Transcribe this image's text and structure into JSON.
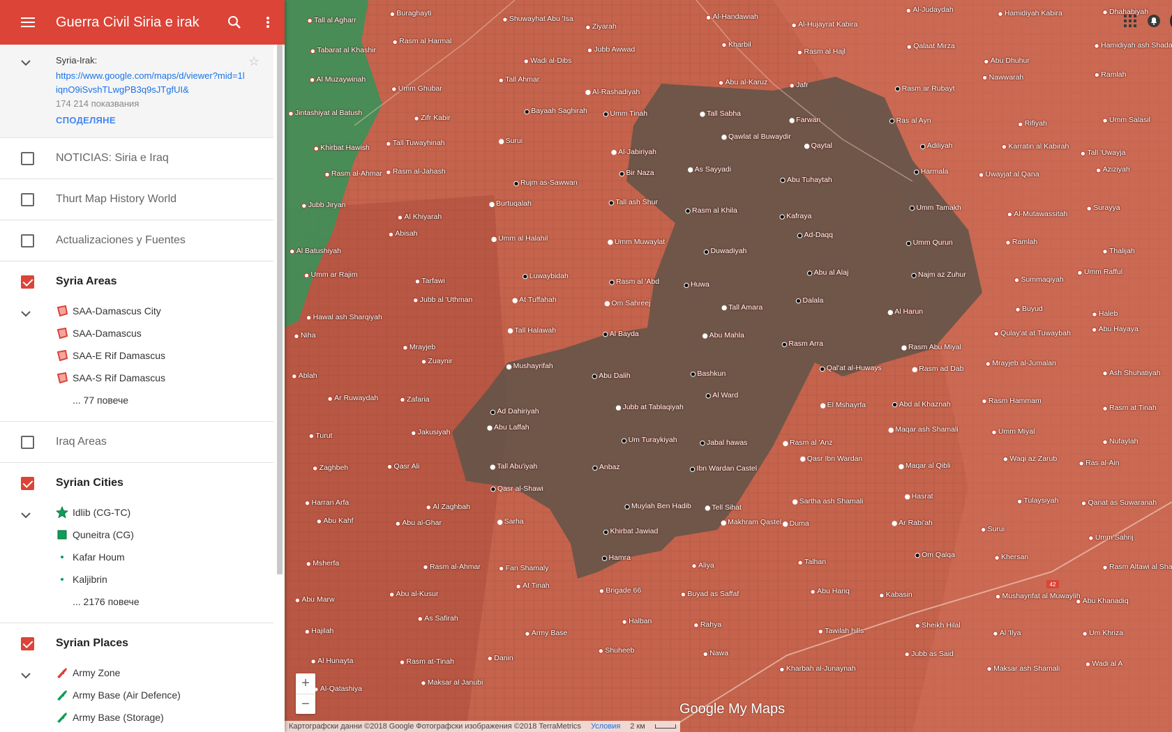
{
  "app": {
    "title": "Guerra Civil Siria e irak"
  },
  "map_info": {
    "name": "Syria-Irak:",
    "url": "https://www.google.com/maps/d/viewer?mid=1liqnO9iSvshTLwgPB3q9sJTgfUI&",
    "views": "174 214 показвания",
    "share_label": "СПОДЕЛЯНЕ"
  },
  "layers": [
    {
      "label": "NOTICIAS: Siria e Iraq",
      "checked": false
    },
    {
      "label": "Thurt Map History World",
      "checked": false
    },
    {
      "label": "Actualizaciones y Fuentes",
      "checked": false
    },
    {
      "label": "Syria Areas",
      "checked": true,
      "items": [
        "SAA-Damascus City",
        "SAA-Damascus",
        "SAA-E Rif Damascus",
        "SAA-S Rif Damascus"
      ],
      "more": "... 77 повече"
    },
    {
      "label": "Iraq Areas",
      "checked": false
    },
    {
      "label": "Syrian Cities",
      "checked": true,
      "items": [
        "Idlib (CG-TC)",
        "Quneitra (CG)",
        "Kafar Houm",
        "Kaljibrin"
      ],
      "more": "... 2176 повече"
    },
    {
      "label": "Syrian Places",
      "checked": true,
      "items": [
        "Army Zone",
        "Army Base (Air Defence)",
        "Army Base (Storage)"
      ]
    }
  ],
  "map": {
    "places": [
      "Tall al Agharr",
      "Buraghayti",
      "Shuwayhat Abu 'Isa",
      "Ziyarah",
      "Al-Handawiah",
      "Al-Hujayrat Kabira",
      "Al-Judaydah",
      "Hamidiyah Kabira",
      "Dhahabiyah",
      "Tabarat al Khashir",
      "Rasm al Harmal",
      "Wadi al-Dibs",
      "Jubb Awwad",
      "Kharbil",
      "Rasm al Hajl",
      "Qalaat Mirza",
      "Abu Dhuhur",
      "Hamidiyah ash Shadad",
      "Al Muzaywinah",
      "Umm Ghubar",
      "Tall Ahmar",
      "Al-Rashadiyah",
      "Abu al-Karuz",
      "Jafr",
      "Rasm ar Rubayt",
      "Nawwarah",
      "Ramlah",
      "Jintashiyat al Batush",
      "Zifr Kabir",
      "Bayaah Saghirah",
      "Umm Tinah",
      "Tall Sabha",
      "Farwan",
      "Ras al Ayn",
      "Rifiyah",
      "Umm Salasil",
      "Khirbat Hawish",
      "Tall Tuwayhinah",
      "Surui",
      "Al-Jabiriyah",
      "Qawlat al Buwaydir",
      "Qaytal",
      "Adiliyah",
      "Karratin al Kabirah",
      "Tall 'Uwayja",
      "Rasm al-Ahmar",
      "Rasm al-Jahash",
      "Rujm as-Sawwan",
      "Bir Naza",
      "As Sayyadi",
      "Abu Tuhaytah",
      "Harmala",
      "Uwayjat al Qana",
      "Aziziyah",
      "Jubb Jiryan",
      "Al Khiyarah",
      "Burtuqalah",
      "Tall ash Shur",
      "Rasm al Khila",
      "Kafraya",
      "Umm Tamakh",
      "Al-Mutawassitah",
      "Surayya",
      "Al Batushiyah",
      "Abisah",
      "Umm al Halahil",
      "Umm Muwaylat",
      "Duwadiyah",
      "Ad-Daqq",
      "Umm Qurun",
      "Ramlah",
      "Thalijah",
      "Umm ar Rajim",
      "Tarfawi",
      "Luwaybidah",
      "Rasm al 'Abd",
      "Huwa",
      "Abu al Alaj",
      "Najm az Zuhur",
      "Summaqiyah",
      "Umm Rafful",
      "Hawal ash Sharqiyah",
      "Jubb al 'Uthman",
      "At Tuffahah",
      "Om Sahreej",
      "Tall Amara",
      "Dalala",
      "Al Harun",
      "Buyud",
      "Haleb",
      "Niha",
      "Mrayjeb",
      "Tall Halawah",
      "Al Bayda",
      "Abu Mahla",
      "Rasm Arra",
      "Rasm Abu Miyal",
      "Qulay'at at Tuwaybah",
      "Abu Hayaya",
      "Ablah",
      "Zuaynir",
      "Mushayrifah",
      "Abu Dalih",
      "Bashkun",
      "Qal'at al-Huways",
      "Rasm ad Dab",
      "Mrayjeb al-Jumalan",
      "Ash Shuhatiyah",
      "Ar Ruwaydah",
      "Zafaria",
      "Ad Dahiriyah",
      "Jubb at Tablaqiyah",
      "Al Ward",
      "El Mshayrfa",
      "Abd al Khaznah",
      "Rasm Hammam",
      "Rasm at Tinah",
      "Turut",
      "Jakusiyah",
      "Abu Laffah",
      "Um Turaykiyah",
      "Jabal hawas",
      "Rasm al 'Anz",
      "Maqar ash Shamali",
      "Umm Miyal",
      "Nufaylah",
      "Zaghbeh",
      "Qasr Ali",
      "Tall Abu'iyah",
      "Anbaz",
      "Ibn Wardan Castel",
      "Qasr Ibn Wardan",
      "Maqar al Qibli",
      "Waqi az Zarub",
      "Ras al-Ain",
      "Harran Arfa",
      "Al Zaghbah",
      "Qasr al-Shawi",
      "Muylah Ben Hadib",
      "Tell Sihat",
      "Sartha ash Shamali",
      "Hasrat",
      "Tulaysiyah",
      "Qanat as Suwaranah",
      "Abu Kahf",
      "Abu al-Ghar",
      "Sarha",
      "Khirbat Jawiad",
      "Makhram Qastel",
      "Duma",
      "Ar Rabi'ah",
      "Surui",
      "Umm Sahrij",
      "Msherfa",
      "Rasm al-Ahmar",
      "Fan Shamaly",
      "Hamra",
      "Aliya",
      "Talhan",
      "Om Qalqa",
      "Khersan",
      "Rasm Altawi al Sharkiyah",
      "Abu Marw",
      "Abu al-Kusur",
      "At Tinah",
      "Brigade 66",
      "Buyad as Saffaf",
      "Abu Hariq",
      "Kabasin",
      "Mushayrifat al Muwaylih",
      "Abu Khanadiq",
      "Hajilah",
      "As Safirah",
      "Army Base",
      "Halban",
      "Rahya",
      "Tawilah hills",
      "Sheikh Hilal",
      "Al 'Ilya",
      "Um Khriza",
      "Al Hunayta",
      "Rasm at-Tinah",
      "Danin",
      "Shuheeb",
      "Nawa",
      "Kharbah al-Junaynah",
      "Jubb as Said",
      "Maksar ash Shamali",
      "Wadi al A",
      "Al-Qatashiya",
      "Maksar al Janubi"
    ],
    "zoom_in": "+",
    "zoom_out": "−",
    "logo": "Google My Maps",
    "attribution": "Картографски данни ©2018 Google Фотографски изображения ©2018 TerraMetrics",
    "terms": "Условия",
    "scale": "2 км"
  },
  "colors": {
    "brand": "#db4437",
    "map_red": "#c9604a",
    "map_green": "#3e8f58",
    "isis_area": "#6e5a4d"
  }
}
